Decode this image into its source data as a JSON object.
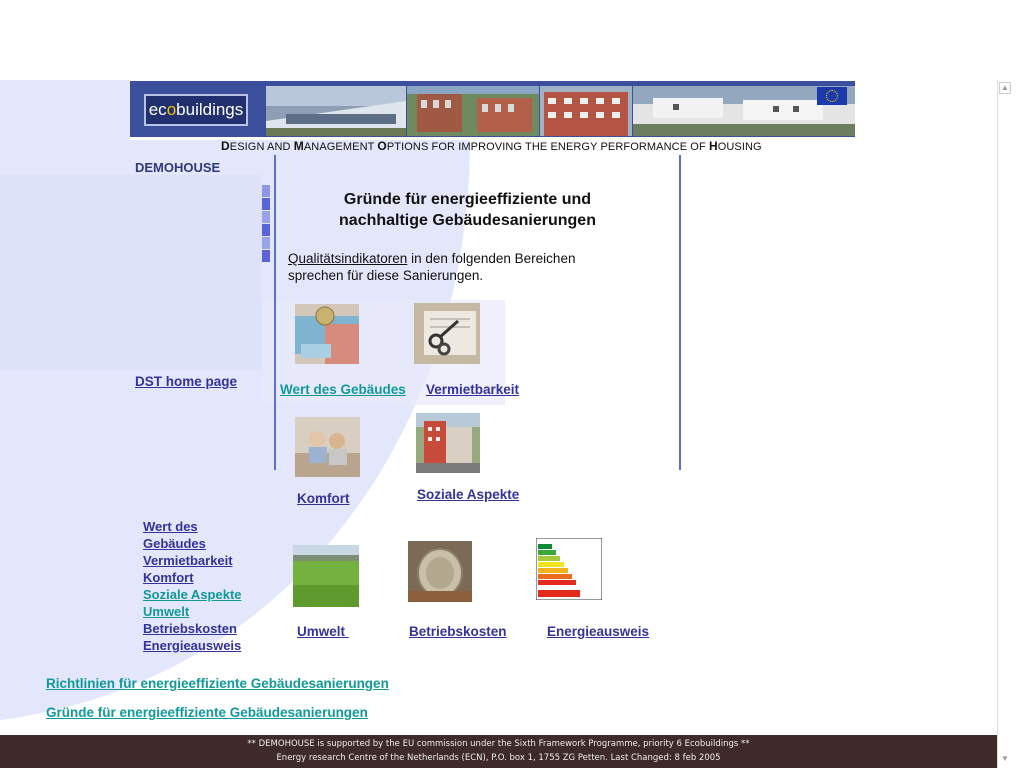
{
  "banner": {
    "logo_text_pre": "ec",
    "logo_text_o": "o",
    "logo_text_post": "buildings",
    "subtitle_parts": [
      "D",
      "ESIGN AND ",
      "M",
      "ANAGEMENT ",
      "O",
      "PTIONS FOR IMPROVING THE ENERGY PERFORMANCE OF ",
      "H",
      "OUSING"
    ]
  },
  "sidebar": {
    "title": "DEMOHOUSE",
    "dst_link": "DST home page",
    "nav": [
      "Wert des",
      "Gebäudes",
      "Vermietbarkeit",
      "Komfort",
      "Soziale Aspekte",
      "Umwelt",
      "Betriebskosten",
      "Energieausweis"
    ]
  },
  "main": {
    "heading_line1": "Gründe für energieeffiziente und",
    "heading_line2": "nachhaltige Gebäudesanierungen",
    "intro_link": "Qualitätsindikatoren",
    "intro_rest": " in den folgenden Bereichen sprechen für diese Sanierungen.",
    "items": [
      {
        "label": "Wert des Gebäudes",
        "icon": "money-image"
      },
      {
        "label": "Vermietbarkeit",
        "icon": "keys-image"
      },
      {
        "label": "Komfort",
        "icon": "people-image"
      },
      {
        "label": "Soziale Aspekte",
        "icon": "building-image"
      },
      {
        "label": "Umwelt ",
        "icon": "grass-image"
      },
      {
        "label": "Betriebskosten",
        "icon": "coin-image"
      },
      {
        "label": "Energieausweis",
        "icon": "energy-label-image"
      }
    ]
  },
  "bottom_links": [
    "Richtlinien für energieeffiziente Gebäudesanierungen",
    "Gründe für energieeffiziente Gebäudesanierungen"
  ],
  "footer": {
    "line1": "** DEMOHOUSE is supported by the EU commission under the Sixth Framework Programme, priority 6 Ecobuildings **",
    "line2": "Energy research Centre of the Netherlands (ECN), P.O. box 1, 1755 ZG Petten. Last Changed: 8 feb 2005"
  },
  "colors": {
    "banner": "#3c4f9c",
    "link": "#333399",
    "link_visited": "#119999",
    "footer": "#3e2a2a",
    "curve": "#e4e7fb"
  }
}
